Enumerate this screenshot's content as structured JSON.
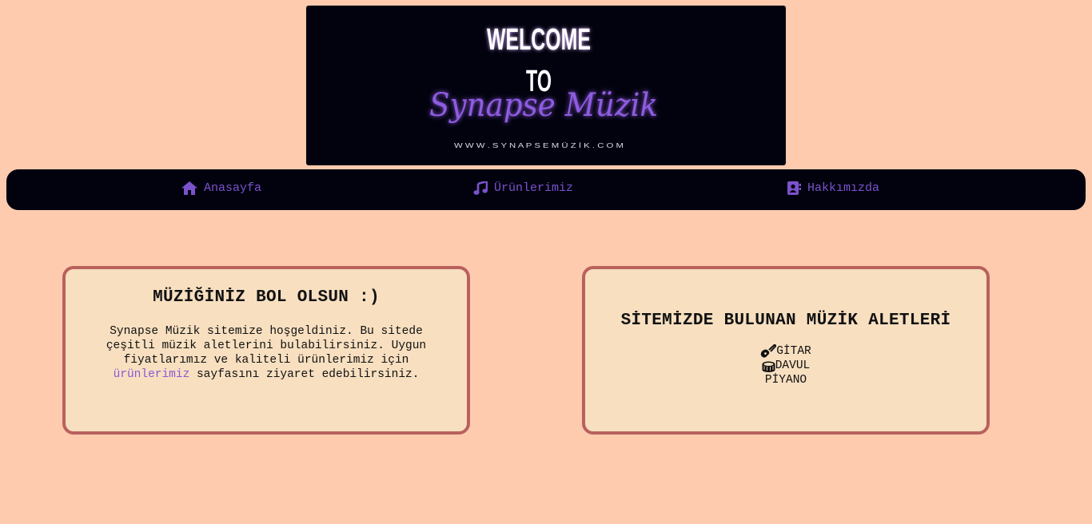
{
  "banner": {
    "line1": "WELCOME",
    "line2": "TO",
    "script": "Synapse Müzik",
    "url": "W W W . S Y N A P S E M Ü Z İ K . C O M"
  },
  "nav": {
    "items": [
      {
        "label": "Anasayfa",
        "icon": "home-icon"
      },
      {
        "label": "Ürünlerimiz",
        "icon": "music-note-icon"
      },
      {
        "label": "Hakkımızda",
        "icon": "address-book-icon"
      }
    ]
  },
  "welcome_card": {
    "title": "MÜZİĞİNİZ BOL OLSUN :)",
    "text_before": "Synapse Müzik sitemize hoşgeldiniz. Bu sitede çeşitli müzik aletlerini bulabilirsiniz. Uygun fiyatlarımız ve kaliteli ürünlerimiz için ",
    "link": "ürünlerimiz",
    "text_after": " sayfasını ziyaret edebilirsiniz."
  },
  "instruments_card": {
    "title": "SİTEMİZDE BULUNAN MÜZİK ALETLERİ",
    "items": [
      {
        "label": "GİTAR",
        "icon": "guitar-icon"
      },
      {
        "label": "DAVUL",
        "icon": "drum-icon"
      },
      {
        "label": "PİYANO",
        "icon": ""
      }
    ]
  },
  "colors": {
    "page_bg": "#ffcbaf",
    "nav_bg": "#02020f",
    "accent": "#7a52cc",
    "card_bg": "#f7dfc0",
    "card_border": "#b9615d"
  }
}
